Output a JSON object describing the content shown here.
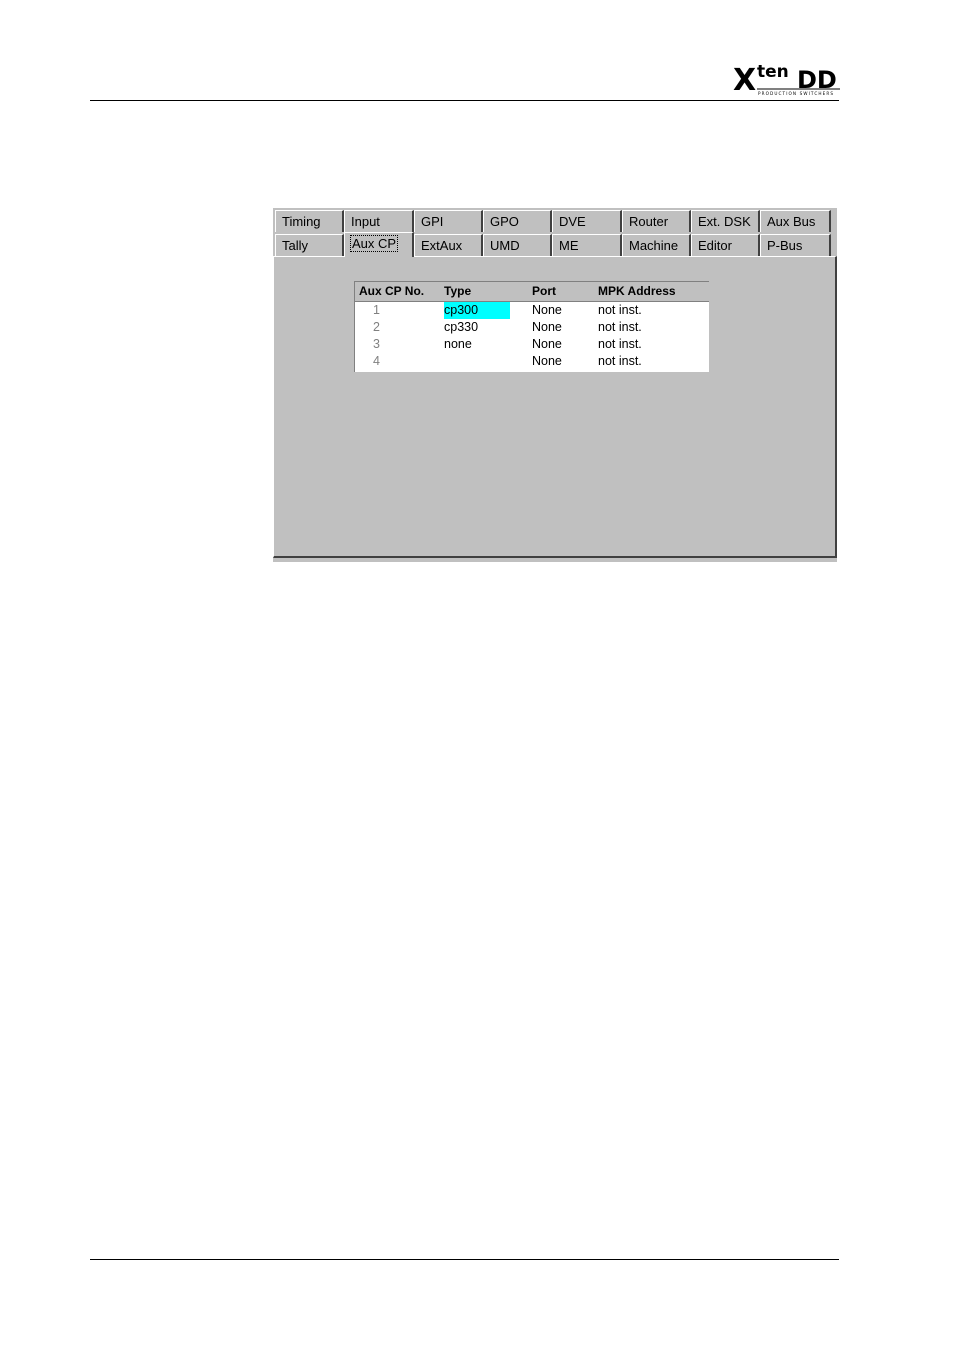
{
  "logo": {
    "text_x": "X",
    "text_ten": "ten",
    "text_dd": "DD",
    "tagline": "PRODUCTION SWITCHERS"
  },
  "tabs": {
    "row1": [
      "Timing",
      "Input",
      "GPI",
      "GPO",
      "DVE",
      "Router",
      "Ext. DSK",
      "Aux Bus"
    ],
    "row2": [
      "Tally",
      "Aux CP",
      "ExtAux",
      "UMD",
      "ME",
      "Machine",
      "Editor",
      "P-Bus"
    ],
    "active": "Aux CP"
  },
  "grid": {
    "columns": [
      "Aux CP No.",
      "Type",
      "Port",
      "MPK Address"
    ],
    "rows": [
      {
        "no": "1",
        "type": "cp300",
        "port": "None",
        "mpk": "not inst.",
        "selected": true
      },
      {
        "no": "2",
        "type": "cp330",
        "port": "None",
        "mpk": "not inst."
      },
      {
        "no": "3",
        "type": "none",
        "port": "None",
        "mpk": "not inst."
      },
      {
        "no": "4",
        "type": "",
        "port": "None",
        "mpk": "not inst."
      }
    ],
    "selection_color": "#00ffff"
  }
}
